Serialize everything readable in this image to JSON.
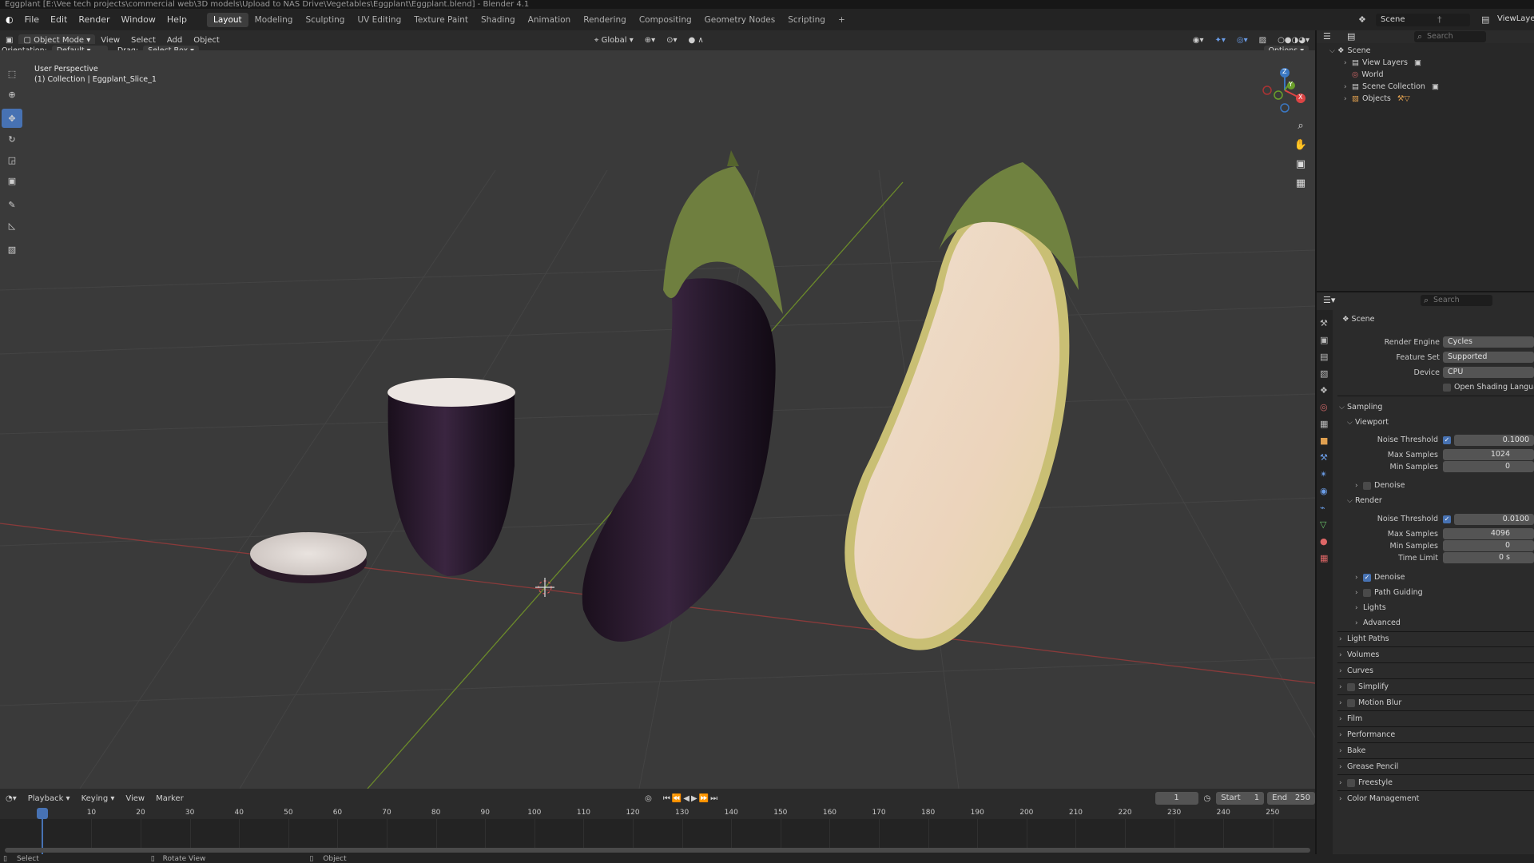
{
  "window": {
    "title": "Eggplant [E:\\Vee tech projects\\commercial web\\3D models\\Upload to NAS Drive\\Vegetables\\Eggplant\\Eggplant.blend] - Blender 4.1"
  },
  "menu": {
    "items": [
      "File",
      "Edit",
      "Render",
      "Window",
      "Help"
    ]
  },
  "workspaces": {
    "tabs": [
      "Layout",
      "Modeling",
      "Sculpting",
      "UV Editing",
      "Texture Paint",
      "Shading",
      "Animation",
      "Rendering",
      "Compositing",
      "Geometry Nodes",
      "Scripting"
    ],
    "active": "Layout",
    "add": "+"
  },
  "top_right": {
    "scene": "Scene",
    "view_layer": "ViewLayer"
  },
  "viewport_header": {
    "mode": "Object Mode",
    "menus": [
      "View",
      "Select",
      "Add",
      "Object"
    ],
    "transform_orientation": "Global",
    "orientation_label": "Orientation:",
    "orientation_value": "Default",
    "drag_label": "Drag:",
    "drag_value": "Select Box",
    "options": "Options"
  },
  "viewport": {
    "perspective": "User Perspective",
    "collection_info": "(1) Collection | Eggplant_Slice_1",
    "gizmo": {
      "z": "Z",
      "y": "Y",
      "x": "X"
    },
    "grid_color": "#3f3f3f",
    "x_axis_color": "#8a3a3a",
    "y_axis_color": "#6b8a2a"
  },
  "icons": {
    "tools": [
      "select-box-icon",
      "cursor-icon",
      "move-icon",
      "rotate-icon",
      "scale-icon",
      "transform-icon",
      "annotate-icon",
      "measure-icon",
      "add-cube-icon"
    ],
    "nav": [
      "zoom-icon",
      "pan-hand-icon",
      "camera-icon",
      "grid-icon"
    ]
  },
  "outliner": {
    "search_placeholder": "Search",
    "items": [
      {
        "label": "Scene",
        "level": 0,
        "expanded": true
      },
      {
        "label": "View Layers",
        "level": 1
      },
      {
        "label": "World",
        "level": 1
      },
      {
        "label": "Scene Collection",
        "level": 1
      },
      {
        "label": "Objects",
        "level": 1
      }
    ]
  },
  "properties": {
    "search_placeholder": "Search",
    "context": "Scene",
    "render_engine_label": "Render Engine",
    "render_engine": "Cycles",
    "feature_set_label": "Feature Set",
    "feature_set": "Supported",
    "device_label": "Device",
    "device": "CPU",
    "osl": "Open Shading Language",
    "sampling": "Sampling",
    "viewport": "Viewport",
    "noise_threshold_label": "Noise Threshold",
    "vp_noise_threshold": "0.1000",
    "max_samples_label": "Max Samples",
    "vp_max_samples": "1024",
    "min_samples_label": "Min Samples",
    "vp_min_samples": "0",
    "denoise": "Denoise",
    "render": "Render",
    "r_noise_threshold": "0.0100",
    "r_max_samples": "4096",
    "r_min_samples": "0",
    "time_limit_label": "Time Limit",
    "r_time_limit": "0 s",
    "path_guiding": "Path Guiding",
    "lights": "Lights",
    "advanced": "Advanced",
    "panels": [
      "Light Paths",
      "Volumes",
      "Curves",
      "Simplify",
      "Motion Blur",
      "Film",
      "Performance",
      "Bake",
      "Grease Pencil",
      "Freestyle",
      "Color Management"
    ]
  },
  "timeline": {
    "menus": [
      "Playback",
      "Keying",
      "View",
      "Marker"
    ],
    "current_frame": "1",
    "start_label": "Start",
    "start": "1",
    "end_label": "End",
    "end": "250",
    "ticks": [
      "1",
      "10",
      "20",
      "30",
      "40",
      "50",
      "60",
      "70",
      "80",
      "90",
      "100",
      "110",
      "120",
      "130",
      "140",
      "150",
      "160",
      "170",
      "180",
      "190",
      "200",
      "210",
      "220",
      "230",
      "240",
      "250"
    ]
  },
  "status": {
    "select": "Select",
    "rotate": "Rotate View",
    "object": "Object"
  }
}
